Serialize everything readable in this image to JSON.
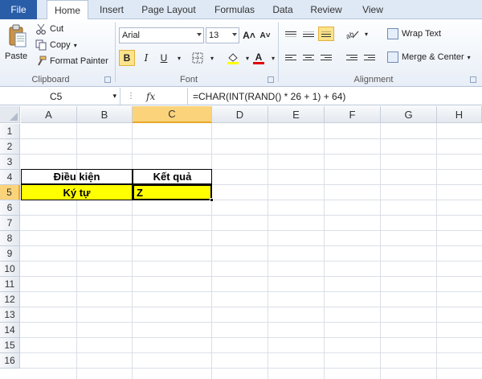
{
  "tabs": [
    "File",
    "Home",
    "Insert",
    "Page Layout",
    "Formulas",
    "Data",
    "Review",
    "View"
  ],
  "active_tab": "Home",
  "clipboard": {
    "paste_label": "Paste",
    "cut_label": "Cut",
    "copy_label": "Copy",
    "format_painter_label": "Format Painter",
    "group_label": "Clipboard"
  },
  "font": {
    "name": "Arial",
    "size": "13",
    "grow_icon": "A˄",
    "shrink_icon": "A˅",
    "bold": "B",
    "italic": "I",
    "underline": "U",
    "group_label": "Font"
  },
  "alignment": {
    "wrap_text_label": "Wrap Text",
    "merge_center_label": "Merge & Center",
    "group_label": "Alignment"
  },
  "formula_bar": {
    "cell_ref": "C5",
    "fx": "fx",
    "formula": "=CHAR(INT(RAND() * 26 + 1) + 64)"
  },
  "columns": [
    "A",
    "B",
    "C",
    "D",
    "E",
    "F",
    "G",
    "H"
  ],
  "rows": [
    "1",
    "2",
    "3",
    "4",
    "5",
    "6",
    "7",
    "8",
    "9",
    "10",
    "11",
    "12",
    "13",
    "14",
    "15",
    "16"
  ],
  "cells": {
    "A4": "Điều kiện",
    "C4": "Kết quả",
    "A5": "Ký tự",
    "C5": "Z"
  },
  "colors": {
    "highlight": "#ffff00",
    "file_tab": "#2a5da8",
    "selected_header": "#fbd37a"
  }
}
